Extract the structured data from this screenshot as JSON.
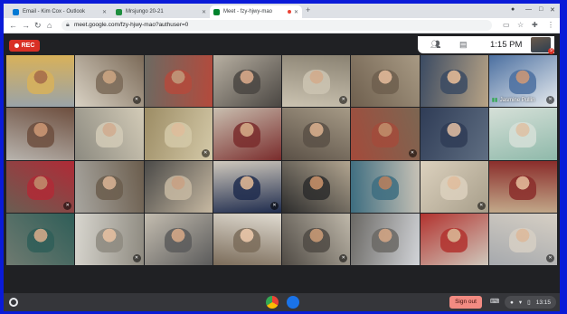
{
  "browser": {
    "tabs": [
      {
        "title": "Email - Kim Cox - Outlook",
        "favicon": "outlook-icon",
        "favicon_color": "#0078d4",
        "active": false
      },
      {
        "title": "Mrsjungo 20-21",
        "favicon": "classroom-icon",
        "favicon_color": "#1e8e3e",
        "active": false
      },
      {
        "title": "Meet - fzy-hjwy-mao",
        "favicon": "meet-icon",
        "favicon_color": "#00832d",
        "active": true,
        "recording": true
      }
    ],
    "new_tab": "+",
    "url": "meet.google.com/fzy-hjwy-mao?authuser=0"
  },
  "meet": {
    "rec_label": "REC",
    "clock": "1:15 PM",
    "participant_count": "9",
    "tiles": [
      {
        "c1": "#9aa3a8",
        "c2": "#d8b15a",
        "skin": "#a86b45"
      },
      {
        "c1": "#d9d2c4",
        "c2": "#7b6a58",
        "skin": "#c8a07c"
      },
      {
        "c1": "#6c6a62",
        "c2": "#b44a3c",
        "skin": "#c79a7a"
      },
      {
        "c1": "#b8b0a2",
        "c2": "#4a4642",
        "skin": "#d6a585"
      },
      {
        "c1": "#8a8272",
        "c2": "#ccc4b2",
        "skin": "#d8b090"
      },
      {
        "c1": "#a89a84",
        "c2": "#6e5f4e",
        "skin": "#e2b898"
      },
      {
        "c1": "#b9a486",
        "c2": "#3a4a62",
        "skin": "#e3b996"
      },
      {
        "c1": "#e8ecef",
        "c2": "#4b6fa0",
        "skin": "#c59070",
        "name": "Jasmine Pullin",
        "speaking": true
      },
      {
        "c1": "#b8b4ae",
        "c2": "#6d4e3e",
        "skin": "#c9926e"
      },
      {
        "c1": "#8c8a80",
        "c2": "#d3cbb7",
        "skin": "#d6b093"
      },
      {
        "c1": "#9c8c64",
        "c2": "#d4c9a8",
        "skin": "#e3c1a0"
      },
      {
        "c1": "#c9bfb0",
        "c2": "#7a2c2c",
        "skin": "#d2a480"
      },
      {
        "c1": "#a69a86",
        "c2": "#5a5046",
        "skin": "#d7ac8a"
      },
      {
        "c1": "#7c6652",
        "c2": "#a34b3b",
        "skin": "#c48e6a"
      },
      {
        "c1": "#5f6e82",
        "c2": "#2f3c56",
        "skin": "#e0bca0"
      },
      {
        "c1": "#8fb9aa",
        "c2": "#d6e0d8",
        "skin": "#e3c3a6"
      },
      {
        "c1": "#6a5e52",
        "c2": "#b02a36",
        "skin": "#c58c6c"
      },
      {
        "c1": "#a8a6a0",
        "c2": "#6b5d4d",
        "skin": "#d7b090"
      },
      {
        "c1": "#4b4a48",
        "c2": "#c7b9a2",
        "skin": "#d2a98a"
      },
      {
        "c1": "#d0c9bd",
        "c2": "#1f2c4e",
        "skin": "#d9b08e"
      },
      {
        "c1": "#b2a590",
        "c2": "#2c2c2c",
        "skin": "#c28a63"
      },
      {
        "c1": "#c8c2b6",
        "c2": "#3d6d80",
        "skin": "#b27a58"
      },
      {
        "c1": "#a79e8a",
        "c2": "#dcd1be",
        "skin": "#e4c0a0"
      },
      {
        "c1": "#c2a98a",
        "c2": "#8a2c2a",
        "skin": "#e3b898"
      },
      {
        "c1": "#6f7a70",
        "c2": "#2f5e58",
        "skin": "#d5ab8a"
      },
      {
        "c1": "#d8d6cf",
        "c2": "#8e8a80",
        "skin": "#e3bc9c"
      },
      {
        "c1": "#c4bdb0",
        "c2": "#5b5b5b",
        "skin": "#d1a382"
      },
      {
        "c1": "#e0dbd1",
        "c2": "#7b6c5a",
        "skin": "#e8c3a4"
      },
      {
        "c1": "#bfb8aa",
        "c2": "#4f4a44",
        "skin": "#c4946f"
      },
      {
        "c1": "#d2d4d8",
        "c2": "#6a6864",
        "skin": "#cfa07e"
      },
      {
        "c1": "#cfc8bc",
        "c2": "#b2322e",
        "skin": "#d9b18f"
      },
      {
        "c1": "#a6a9ad",
        "c2": "#d6cfc4",
        "skin": "#e0bb9b"
      }
    ]
  },
  "shelf": {
    "sign_out": "Sign out",
    "time": "13:15",
    "apps": [
      {
        "name": "chrome-icon",
        "color": "#ea4335"
      },
      {
        "name": "meet-app-icon",
        "color": "#1a73e8"
      }
    ]
  }
}
